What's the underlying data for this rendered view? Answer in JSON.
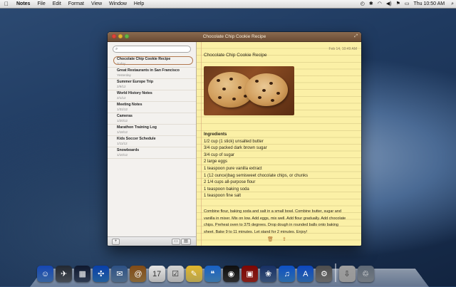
{
  "menubar": {
    "apple": "",
    "app_name": "Notes",
    "menus": [
      "File",
      "Edit",
      "Format",
      "View",
      "Window",
      "Help"
    ],
    "clock": "Thu 10:50 AM"
  },
  "window": {
    "title": "Chocolate Chip Cookie Recipe"
  },
  "sidebar": {
    "search_placeholder": "",
    "notes": [
      {
        "title": "Chocolate Chip Cookie Recipe",
        "date": "Today"
      },
      {
        "title": "Great Restaurants in San Francisco",
        "date": "Yesterday"
      },
      {
        "title": "Summer Europe Trip",
        "date": "2/9/12"
      },
      {
        "title": "World History Notes",
        "date": "2/1/12"
      },
      {
        "title": "Meeting Notes",
        "date": "1/31/12"
      },
      {
        "title": "Cameras",
        "date": "1/20/12"
      },
      {
        "title": "Marathon Training Log",
        "date": "1/18/12"
      },
      {
        "title": "Kids Soccer Schedule",
        "date": "1/11/12"
      },
      {
        "title": "Snowboards",
        "date": "1/10/12"
      }
    ],
    "add_label": "+"
  },
  "note": {
    "date": "Feb 14, 10:49 AM",
    "title": "Chocolate Chip Cookie Recipe",
    "ingredients_heading": "Ingredients",
    "ingredients": [
      "1/2 cup (1 stick) unsalted butter",
      "3/4 cup packed dark brown sugar",
      "3/4 cup of sugar",
      "2 large eggs",
      "1 teaspoon pure vanilla extract",
      "1 (12 ounce)bag semisweet chocolate chips, or chunks",
      "2 1/4 cups all-purpose flour",
      "1 teaspoon baking soda",
      "1 teaspoon fine salt"
    ],
    "paragraph_lines": [
      "Combine flour, baking soda and salt in a small bowl. Combine butter, sugar and",
      "vanilla in mixer. Mix on low. Add eggs, mix well. Add flour gradually. Add chocolate",
      "chips. Preheat oven to 375 degrees. Drop dough in rounded balls onto baking",
      "sheet. Bake 9 to 11 minutes. Let stand for 2 minutes. Enjoy!"
    ]
  },
  "colors": {
    "titlebar": "#7a5a40",
    "note_paper": "#fbf0a6",
    "selection_outline": "#b2784e"
  },
  "dock": {
    "icons": [
      {
        "name": "finder-icon",
        "color": "#4a86d6",
        "glyph": "☺"
      },
      {
        "name": "launchpad-icon",
        "color": "#5d6570",
        "glyph": "✈"
      },
      {
        "name": "mission-control-icon",
        "color": "#3d4e6c",
        "glyph": "▦"
      },
      {
        "name": "safari-icon",
        "color": "#2f7fd0",
        "glyph": "✣"
      },
      {
        "name": "mail-icon",
        "color": "#6a8fb8",
        "glyph": "✉"
      },
      {
        "name": "contacts-icon",
        "color": "#b58a4c",
        "glyph": "@"
      },
      {
        "name": "calendar-icon",
        "color": "#f2f2f2",
        "glyph": "17"
      },
      {
        "name": "reminders-icon",
        "color": "#e8e8e8",
        "glyph": "☑"
      },
      {
        "name": "notes-icon",
        "color": "#f0d86a",
        "glyph": "✎"
      },
      {
        "name": "messages-icon",
        "color": "#4f9de0",
        "glyph": "❝"
      },
      {
        "name": "facetime-icon",
        "color": "#3c3c3c",
        "glyph": "◉"
      },
      {
        "name": "photo-booth-icon",
        "color": "#b22a22",
        "glyph": "▣"
      },
      {
        "name": "iphoto-icon",
        "color": "#4c6ea0",
        "glyph": "❀"
      },
      {
        "name": "itunes-icon",
        "color": "#3c8fe0",
        "glyph": "♫"
      },
      {
        "name": "app-store-icon",
        "color": "#3a86dc",
        "glyph": "A"
      },
      {
        "name": "system-preferences-icon",
        "color": "#8c8c8c",
        "glyph": "⚙"
      },
      {
        "name": "downloads-stack-icon",
        "color": "#c9c9c9",
        "glyph": "⇩"
      },
      {
        "name": "trash-icon",
        "color": "#9aa3ad",
        "glyph": "♲"
      }
    ]
  }
}
